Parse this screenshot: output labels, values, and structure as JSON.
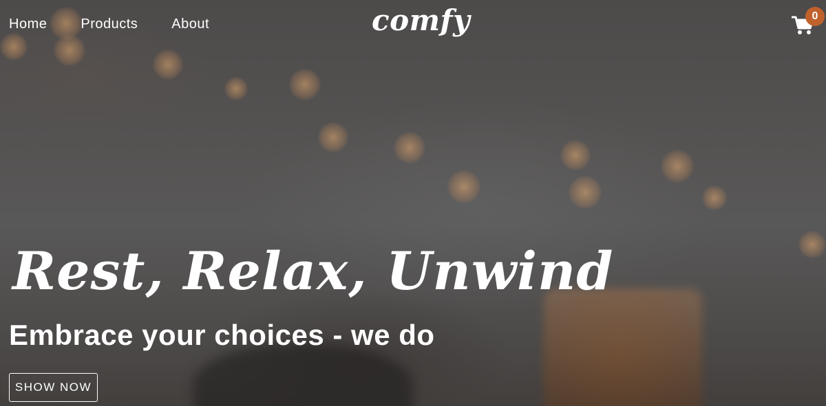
{
  "nav": {
    "links": [
      {
        "label": "Home"
      },
      {
        "label": "Products"
      },
      {
        "label": "About"
      }
    ]
  },
  "brand": {
    "logo_text": "comfy"
  },
  "cart": {
    "icon": "cart-icon",
    "count": "0",
    "badge_color": "#c0612b"
  },
  "hero": {
    "title": "Rest, Relax, Unwind",
    "subtitle": "Embrace your choices - we do",
    "cta_label": "SHOW NOW"
  }
}
